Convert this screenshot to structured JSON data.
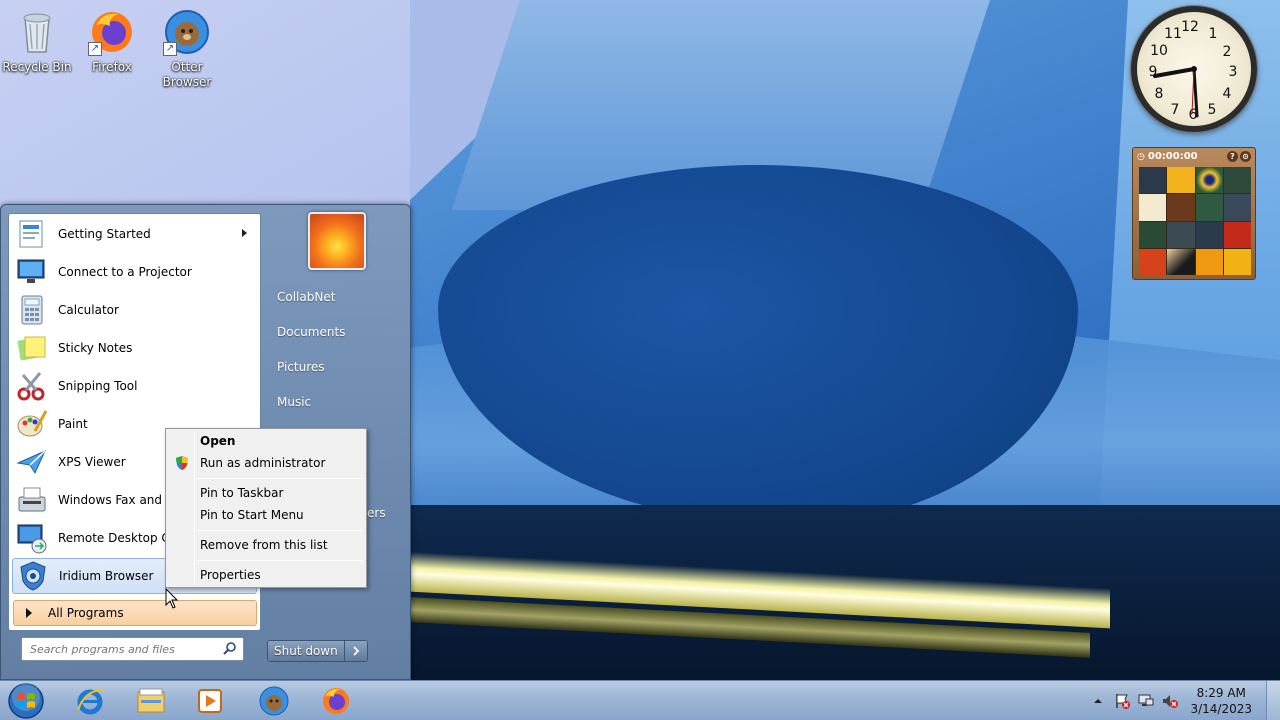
{
  "desktop": {
    "icons": [
      {
        "label": "Recycle Bin",
        "icon": "recycle-bin-icon"
      },
      {
        "label": "Firefox",
        "icon": "firefox-icon"
      },
      {
        "label": "Otter Browser",
        "icon": "otter-browser-icon"
      }
    ]
  },
  "gadgets": {
    "clock": {
      "numbers": [
        "12",
        "1",
        "2",
        "3",
        "4",
        "5",
        "6",
        "7",
        "8",
        "9",
        "10",
        "11"
      ]
    },
    "puzzle": {
      "timer": "00:00:00"
    }
  },
  "start_menu": {
    "programs": [
      {
        "label": "Getting Started",
        "icon": "getting-started-icon"
      },
      {
        "label": "Connect to a Projector",
        "icon": "projector-icon"
      },
      {
        "label": "Calculator",
        "icon": "calculator-icon"
      },
      {
        "label": "Sticky Notes",
        "icon": "sticky-notes-icon"
      },
      {
        "label": "Snipping Tool",
        "icon": "snipping-tool-icon"
      },
      {
        "label": "Paint",
        "icon": "paint-icon"
      },
      {
        "label": "XPS Viewer",
        "icon": "xps-viewer-icon"
      },
      {
        "label": "Windows Fax and Sca",
        "icon": "fax-scan-icon"
      },
      {
        "label": "Remote Desktop Conn",
        "icon": "remote-desktop-icon"
      },
      {
        "label": "Iridium Browser",
        "icon": "iridium-browser-icon"
      }
    ],
    "all_programs": "All Programs",
    "search_placeholder": "Search programs and files",
    "right_links": [
      "CollabNet",
      "Documents",
      "Pictures",
      "Music"
    ],
    "right_link_partial": "ers",
    "shutdown_label": "Shut down"
  },
  "context_menu": {
    "items": [
      "Open",
      "Run as administrator",
      "Pin to Taskbar",
      "Pin to Start Menu",
      "Remove from this list",
      "Properties"
    ]
  },
  "taskbar": {
    "pinned": [
      "internet-explorer-icon",
      "windows-explorer-icon",
      "media-player-icon",
      "otter-browser-icon",
      "firefox-icon"
    ],
    "time": "8:29 AM",
    "date": "3/14/2023"
  },
  "colors": {
    "start_menu_frame": "#7896b9",
    "all_programs_bg": "#f9cf9f",
    "taskbar_bg": "#9db5d6"
  }
}
